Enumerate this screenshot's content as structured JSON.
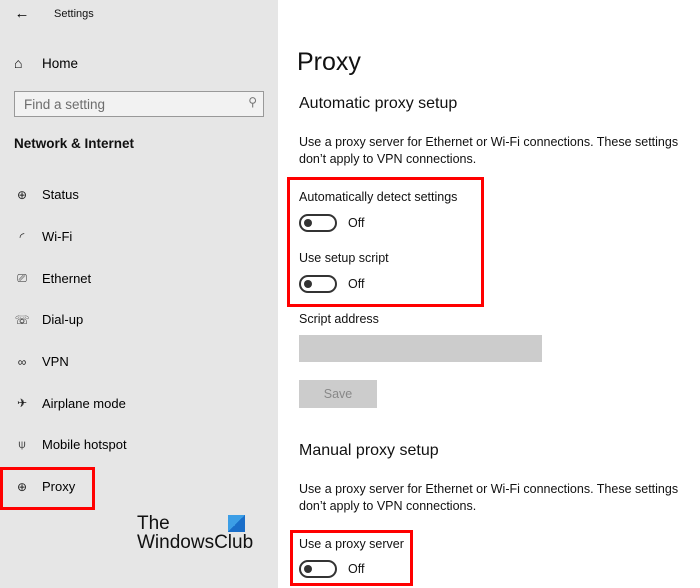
{
  "window": {
    "title": "Settings",
    "back_icon": "←"
  },
  "sidebar": {
    "home": {
      "label": "Home",
      "icon": "⌂"
    },
    "search": {
      "placeholder": "Find a setting",
      "value": "",
      "icon": "⚲"
    },
    "section_title": "Network & Internet",
    "items": [
      {
        "label": "Status",
        "icon": "⊕"
      },
      {
        "label": "Wi-Fi",
        "icon": "◜"
      },
      {
        "label": "Ethernet",
        "icon": "⎚"
      },
      {
        "label": "Dial-up",
        "icon": "☏"
      },
      {
        "label": "VPN",
        "icon": "∞"
      },
      {
        "label": "Airplane mode",
        "icon": "✈"
      },
      {
        "label": "Mobile hotspot",
        "icon": "⍦"
      },
      {
        "label": "Proxy",
        "icon": "⊕",
        "selected": true
      }
    ]
  },
  "logo": {
    "line1": "The",
    "line2": "WindowsClub"
  },
  "main": {
    "title": "Proxy",
    "automatic": {
      "heading": "Automatic proxy setup",
      "description": "Use a proxy server for Ethernet or Wi-Fi connections. These settings don’t apply to VPN connections.",
      "auto_detect": {
        "label": "Automatically detect settings",
        "state": "Off"
      },
      "setup_script": {
        "label": "Use setup script",
        "state": "Off"
      },
      "script_address": {
        "label": "Script address",
        "value": ""
      },
      "save_label": "Save"
    },
    "manual": {
      "heading": "Manual proxy setup",
      "description": "Use a proxy server for Ethernet or Wi-Fi connections. These settings don’t apply to VPN connections.",
      "use_proxy": {
        "label": "Use a proxy server",
        "state": "Off"
      }
    }
  },
  "colors": {
    "highlight": "#ff0000",
    "sidebar_bg": "#e6e6e6",
    "disabled": "#cccccc"
  }
}
